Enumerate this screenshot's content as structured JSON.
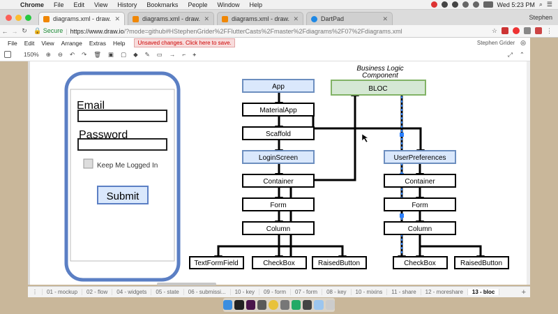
{
  "menubar": {
    "app": "Chrome",
    "items": [
      "File",
      "Edit",
      "View",
      "History",
      "Bookmarks",
      "People",
      "Window",
      "Help"
    ],
    "clock": "Wed 5:23 PM"
  },
  "tabs": [
    {
      "title": "diagrams.xml - draw.io",
      "active": true
    },
    {
      "title": "diagrams.xml - draw.io",
      "active": false
    },
    {
      "title": "diagrams.xml - draw.io",
      "active": false
    },
    {
      "title": "DartPad",
      "active": false
    }
  ],
  "profile": "Stephen",
  "address": {
    "secure": "Secure",
    "url": "https://www.draw.io",
    "url_rest": "/?mode=github#HStephenGrider%2FFlutterCasts%2Fmaster%2Fdiagrams%2F07%2Fdiagrams.xml"
  },
  "drawio": {
    "menus": [
      "File",
      "Edit",
      "View",
      "Arrange",
      "Extras",
      "Help"
    ],
    "unsaved": "Unsaved changes. Click here to save.",
    "user": "Stephen Grider",
    "zoom": "150%"
  },
  "mockup": {
    "email_label": "Email",
    "password_label": "Password",
    "checkbox_label": "Keep Me Logged In",
    "submit_label": "Submit"
  },
  "diagram": {
    "group_label_1": "Business Logic",
    "group_label_2": "Component",
    "bloc": "BLOC",
    "left_stack": [
      "App",
      "MaterialApp",
      "Scaffold",
      "LoginScreen",
      "Container",
      "Form",
      "Column"
    ],
    "right_stack": [
      "UserPreferences",
      "Container",
      "Form",
      "Column"
    ],
    "left_leaves": [
      "TextFormField",
      "CheckBox",
      "RaisedButton"
    ],
    "right_leaves": [
      "CheckBox",
      "RaisedButton"
    ]
  },
  "pages": [
    "01 - mockup",
    "02 - flow",
    "04 - widgets",
    "05 - state",
    "06 - submissi...",
    "10 - key",
    "09 - form",
    "07 - form",
    "08 - key",
    "10 - mixins",
    "11 - share",
    "12 - moreshare",
    "13 - bloc"
  ],
  "active_page": "13 - bloc",
  "colors": {
    "blue_fill": "#dae8fc",
    "blue_stroke": "#6c8ebf",
    "green_fill": "#d5e8d4",
    "green_stroke": "#82b366",
    "phone_stroke": "#5b7fc4",
    "submit_fill": "#dae8fc",
    "unsaved_bg": "#f8dcdc"
  }
}
